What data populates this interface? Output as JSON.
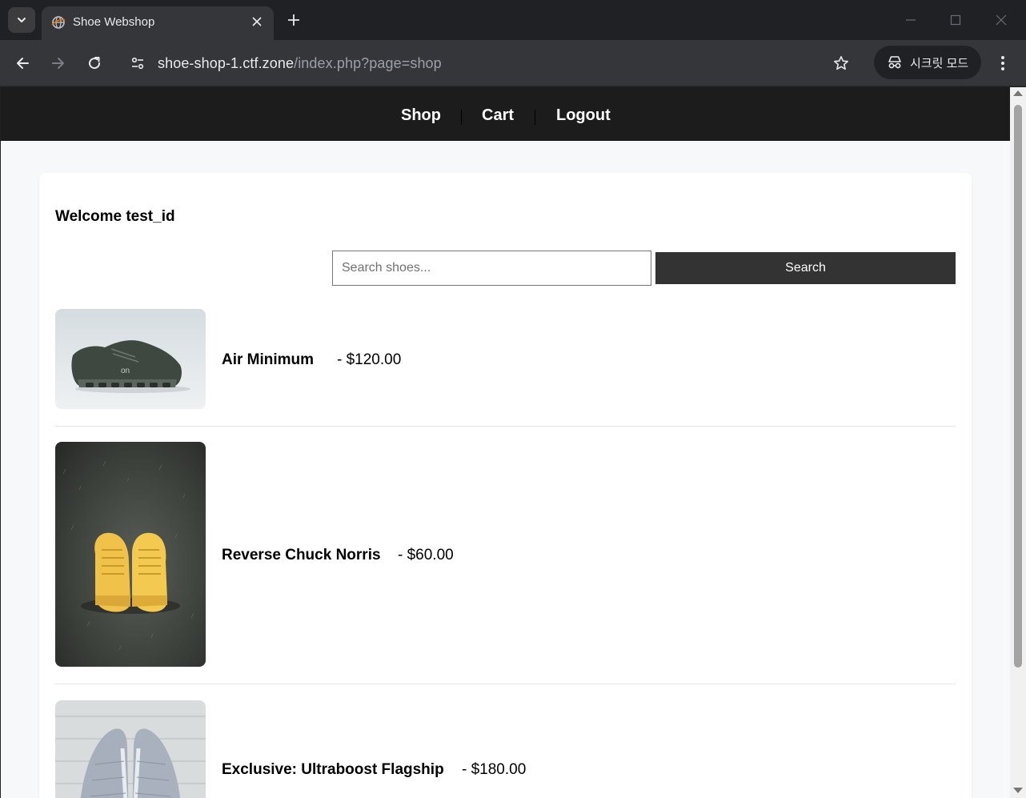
{
  "browser": {
    "tab_title": "Shoe Webshop",
    "url_host": "shoe-shop-1.ctf.zone",
    "url_path": "/index.php?page=shop",
    "incognito_label": "시크릿 모드",
    "icons": {
      "tab_search": "chevron-down-icon",
      "favicon": "globe-icon",
      "tab_close": "close-icon",
      "new_tab": "plus-icon",
      "minimize": "minimize-icon",
      "maximize": "maximize-icon",
      "window_close": "close-icon",
      "back": "arrow-left-icon",
      "forward": "arrow-right-icon",
      "reload": "reload-icon",
      "site_info": "tune-icon",
      "bookmark": "star-icon",
      "incognito": "incognito-icon",
      "menu": "more-vert-icon"
    }
  },
  "site_nav": {
    "shop": "Shop",
    "cart": "Cart",
    "logout": "Logout"
  },
  "main": {
    "welcome": "Welcome test_id",
    "search_placeholder": "Search shoes...",
    "search_button": "Search"
  },
  "products": [
    {
      "name": "Air Minimum",
      "price": "- $120.00",
      "image": "dark-olive-running-shoe-photo"
    },
    {
      "name": "Reverse Chuck Norris",
      "price": "- $60.00",
      "image": "yellow-sneakers-on-grass-photo"
    },
    {
      "name": "Exclusive: Ultraboost Flagship",
      "price": "- $180.00",
      "image": "light-grey-sneakers-on-wood-photo"
    }
  ],
  "colors": {
    "nav_bg": "#1c1c1c",
    "page_bg": "#f6f8fa",
    "button_bg": "#333333",
    "chrome_bg": "#202124",
    "toolbar_bg": "#35363a"
  }
}
